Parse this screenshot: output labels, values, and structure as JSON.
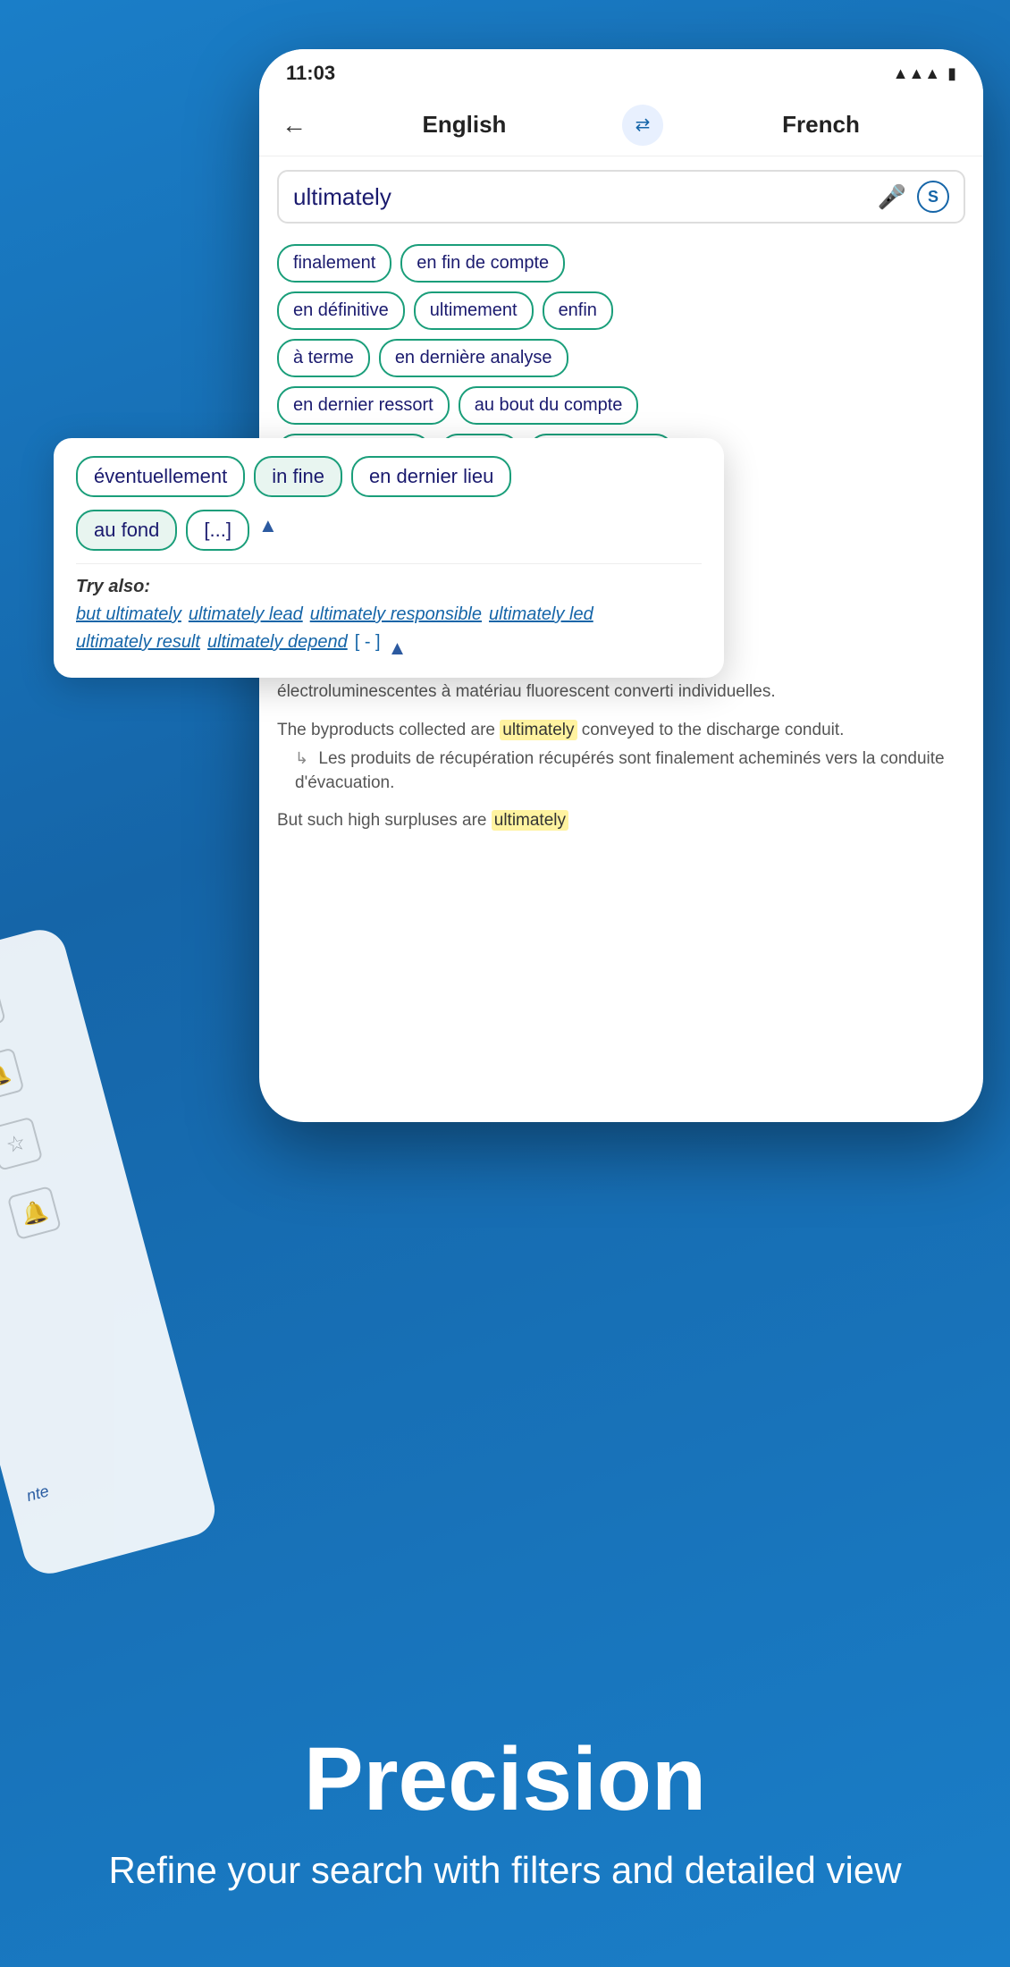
{
  "status": {
    "time": "11:03",
    "signal": "📶",
    "battery": "🔋"
  },
  "header": {
    "back_label": "←",
    "lang_source": "English",
    "lang_target": "French",
    "swap_icon": "⇄"
  },
  "search": {
    "query": "ultimately",
    "mic_icon": "🎤",
    "badge_label": "S"
  },
  "chips": {
    "row1": [
      "finalement",
      "en fin de compte"
    ],
    "row2": [
      "en définitive",
      "ultimement",
      "enfin"
    ],
    "row3": [
      "à terme",
      "en dernière analyse"
    ],
    "row4": [
      "en dernier ressort",
      "au bout du compte"
    ],
    "row5_partial": [
      "éventuellement",
      "in fine",
      "en dernier lieu"
    ]
  },
  "overlay": {
    "chips_row1": [
      "éventuellement",
      "in fine",
      "en dernier lieu"
    ],
    "chips_row2_left": "au fond",
    "chips_row2_right": "[...]",
    "try_also_label": "Try also:",
    "try_links": [
      "but ultimately",
      "ultimately lead",
      "ultimately responsible",
      "ultimately led",
      "ultimately result",
      "ultimately depend"
    ],
    "bracket_link": "[ - ]",
    "collapse_icon": "▲"
  },
  "examples": {
    "block1": {
      "en_text": "The byproducts collected are",
      "en_highlight": "ultimately",
      "en_rest": "conveyed to the discharge conduit.",
      "fr_text": "Les produits de récupération récupérés sont finalement acheminés vers la conduite d'évacuation."
    },
    "block2_partial": "But such high surpluses are",
    "block2_highlight": "ultimately"
  },
  "bottom": {
    "title": "Precision",
    "subtitle": "Refine your search with filters and detailed view"
  },
  "bg_card": {
    "text": "nte"
  }
}
